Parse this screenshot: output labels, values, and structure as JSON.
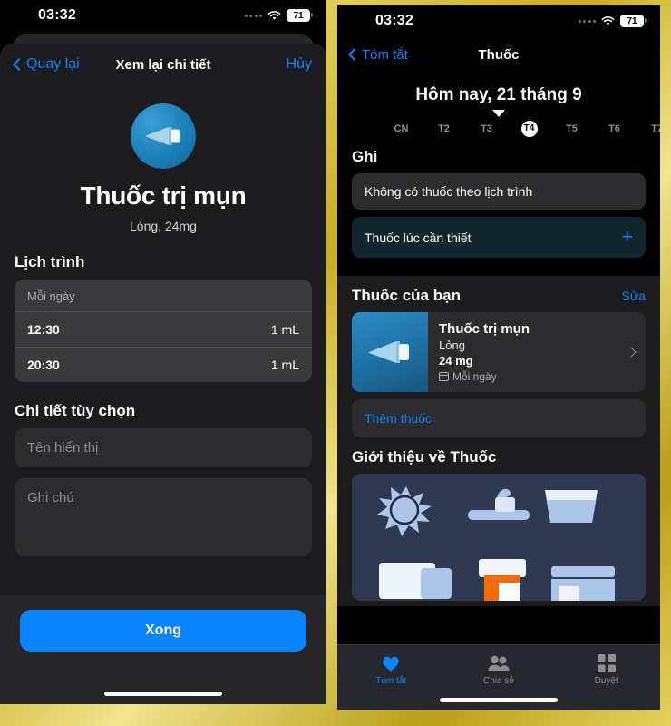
{
  "left": {
    "status": {
      "time": "03:32",
      "battery": "71",
      "signal_icon": "signal-dots-icon",
      "wifi_icon": "wifi-icon",
      "battery_icon": "battery-icon"
    },
    "nav": {
      "back_label": "Quay lại",
      "title": "Xem lại chi tiết",
      "cancel_label": "Hủy"
    },
    "hero": {
      "icon": "medication-tube-icon",
      "name": "Thuốc trị mụn",
      "subtitle": "Lỏng, 24mg"
    },
    "schedule": {
      "section_title": "Lịch trình",
      "frequency": "Mỗi ngày",
      "rows": [
        {
          "time": "12:30",
          "dose": "1 mL"
        },
        {
          "time": "20:30",
          "dose": "1 mL"
        }
      ]
    },
    "optional": {
      "section_title": "Chi tiết tùy chọn",
      "display_name_placeholder": "Tên hiển thị",
      "display_name_value": "",
      "note_placeholder": "Ghi chú",
      "note_value": ""
    },
    "footer": {
      "done_label": "Xong"
    }
  },
  "right": {
    "status": {
      "time": "03:32",
      "battery": "71"
    },
    "nav": {
      "back_label": "Tóm tắt",
      "title": "Thuốc"
    },
    "date": {
      "label": "Hôm nay, 21 tháng 9",
      "caret_icon": "caret-down-icon"
    },
    "days": [
      {
        "label": "",
        "selected": false,
        "edge": true
      },
      {
        "label": "CN",
        "selected": false
      },
      {
        "label": "T2",
        "selected": false
      },
      {
        "label": "T3",
        "selected": false
      },
      {
        "label": "T4",
        "selected": true
      },
      {
        "label": "T5",
        "selected": false
      },
      {
        "label": "T6",
        "selected": false
      },
      {
        "label": "T7",
        "selected": false
      },
      {
        "label": "",
        "selected": false,
        "edge": true
      }
    ],
    "log": {
      "section_title": "Ghi",
      "empty_text": "Không có thuốc theo lịch trình",
      "as_needed_text": "Thuốc lúc cần thiết",
      "add_icon": "plus-icon"
    },
    "meds": {
      "section_title": "Thuốc của bạn",
      "edit_label": "Sửa",
      "items": [
        {
          "name": "Thuốc trị mụn",
          "form": "Lỏng",
          "strength": "24 mg",
          "schedule": "Mỗi ngày",
          "thumb_icon": "medication-tube-icon",
          "chevron_icon": "chevron-right-icon",
          "calendar_icon": "calendar-icon"
        }
      ],
      "add_label": "Thêm thuốc"
    },
    "about": {
      "section_title": "Giới thiệu về Thuốc",
      "illustration": "medication-illustration"
    },
    "tabs": [
      {
        "label": "Tóm tắt",
        "icon": "heart-icon",
        "active": true
      },
      {
        "label": "Chia sẻ",
        "icon": "people-icon",
        "active": false
      },
      {
        "label": "Duyệt",
        "icon": "grid-icon",
        "active": false
      }
    ]
  },
  "colors": {
    "accent": "#0a84ff",
    "sheet_bg": "#1c1c1e",
    "card_bg": "#3a3a3c",
    "teal_card": "#11272d",
    "frame": "#d8c23c"
  }
}
